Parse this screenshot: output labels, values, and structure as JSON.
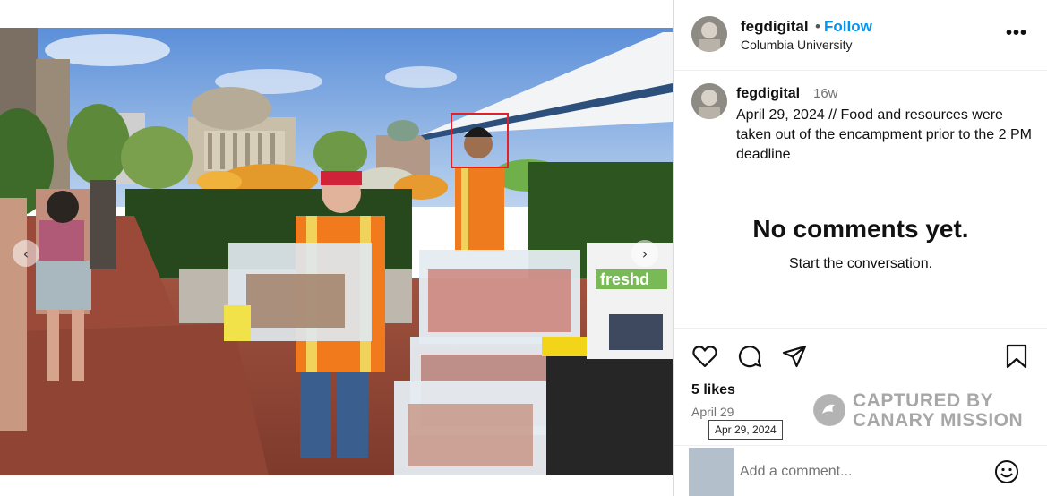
{
  "post": {
    "username": "fegdigital",
    "follow_label": "Follow",
    "separator": "•",
    "location": "Columbia University",
    "more_label": "•••"
  },
  "caption": {
    "username": "fegdigital",
    "age": "16w",
    "text": "April 29, 2024 // Food and resources were taken out of the encampment prior to the 2 PM deadline"
  },
  "comments": {
    "empty_title": "No comments yet.",
    "empty_subtitle": "Start the conversation."
  },
  "actions": {
    "icons": [
      "heart-icon",
      "comment-icon",
      "share-icon",
      "bookmark-icon"
    ]
  },
  "likes": "5 likes",
  "date": "April 29",
  "date_tooltip": "Apr 29, 2024",
  "watermark": {
    "line1": "CAPTURED BY",
    "line2": "CANARY MISSION"
  },
  "comment_box": {
    "placeholder": "Add a comment..."
  },
  "photo": {
    "description_icon": "photo",
    "nav_left": "‹",
    "nav_right": "›"
  }
}
